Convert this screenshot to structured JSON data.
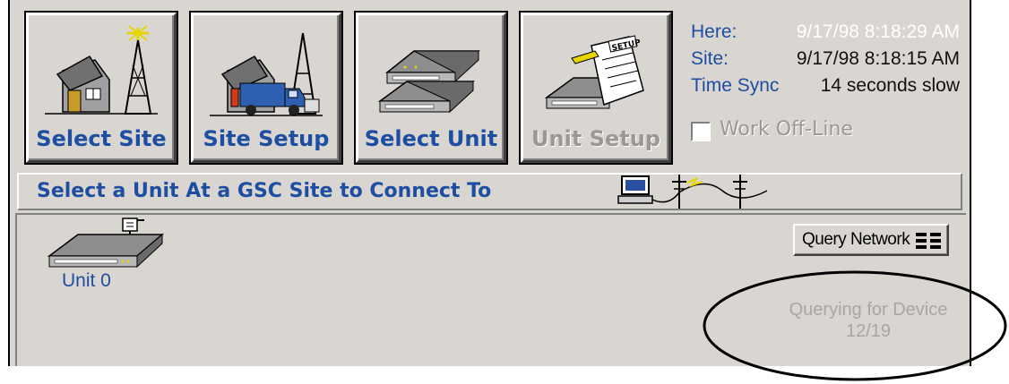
{
  "toolbar": {
    "buttons": [
      {
        "label": "Select Site",
        "icon": "site-tower-icon",
        "enabled": true
      },
      {
        "label": "Site Setup",
        "icon": "site-truck-icon",
        "enabled": true
      },
      {
        "label": "Select Unit",
        "icon": "unit-device-icon",
        "enabled": true
      },
      {
        "label": "Unit Setup",
        "icon": "unit-setup-icon",
        "enabled": false
      }
    ]
  },
  "status": {
    "here_label": "Here:",
    "here_value": "9/17/98 8:18:29 AM",
    "site_label": "Site:",
    "site_value": "9/17/98 8:18:15 AM",
    "timesync_label": "Time Sync",
    "timesync_value": "14 seconds slow",
    "offline_label": "Work Off-Line",
    "offline_checked": false
  },
  "instruction": {
    "text": "Select a Unit At a GSC Site to Connect To",
    "icon": "connection-icon"
  },
  "units": [
    {
      "label": "Unit 0",
      "icon": "network-unit-icon"
    }
  ],
  "query": {
    "button_label": "Query Network",
    "button_icon": "grid-icon",
    "status_line1": "Querying for Device",
    "status_line2": "12/19"
  },
  "colors": {
    "accent": "#1d4ea1",
    "window_bg": "#d9d6d2",
    "disabled_text": "#9a9894"
  }
}
